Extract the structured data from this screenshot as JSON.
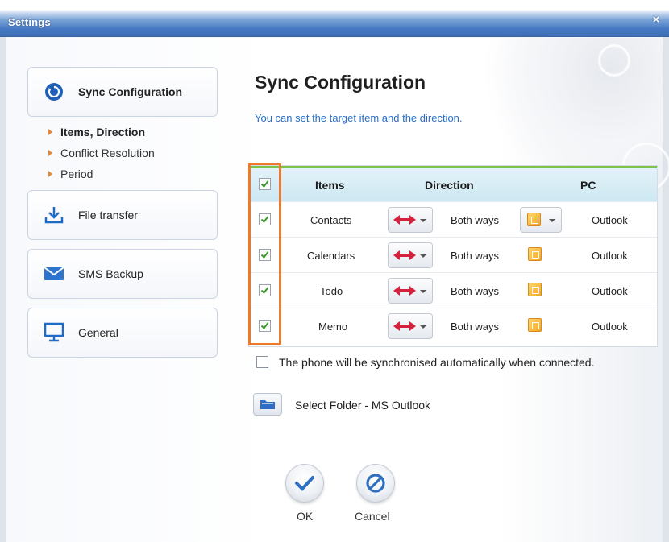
{
  "window": {
    "title": "Settings",
    "close_glyph": "×"
  },
  "sidebar": {
    "items": [
      {
        "label": "Sync Configuration",
        "icon": "sync-icon",
        "active": true
      },
      {
        "label": "File transfer",
        "icon": "download-icon"
      },
      {
        "label": "SMS Backup",
        "icon": "envelope-icon"
      },
      {
        "label": "General",
        "icon": "monitor-icon"
      }
    ],
    "subitems": [
      {
        "label": "Items, Direction",
        "active": true
      },
      {
        "label": "Conflict Resolution"
      },
      {
        "label": "Period"
      }
    ]
  },
  "main": {
    "heading": "Sync Configuration",
    "subtitle": "You can set the target item and the direction.",
    "table": {
      "headers": {
        "items": "Items",
        "direction": "Direction",
        "pc": "PC"
      },
      "rows": [
        {
          "item": "Contacts",
          "direction": "Both ways",
          "pc": "Outlook",
          "checked": true
        },
        {
          "item": "Calendars",
          "direction": "Both ways",
          "pc": "Outlook",
          "checked": true
        },
        {
          "item": "Todo",
          "direction": "Both ways",
          "pc": "Outlook",
          "checked": true
        },
        {
          "item": "Memo",
          "direction": "Both ways",
          "pc": "Outlook",
          "checked": true
        }
      ]
    },
    "auto_sync_label": "The phone will be synchronised automatically when connected.",
    "auto_sync_checked": false,
    "folder_label": "Select Folder - MS Outlook"
  },
  "buttons": {
    "ok": "OK",
    "cancel": "Cancel"
  },
  "colors": {
    "accent_blue": "#2a6ec8",
    "highlight_orange": "#f0782a",
    "check_green": "#3a9a2a",
    "arrow_red": "#d4213d"
  }
}
